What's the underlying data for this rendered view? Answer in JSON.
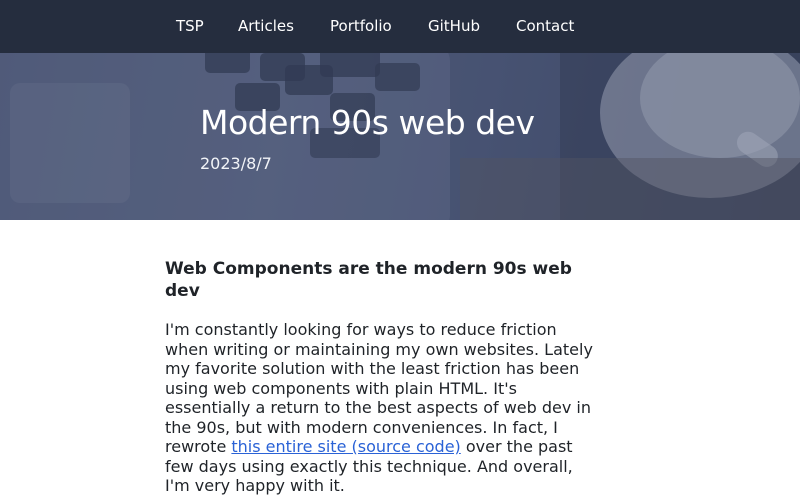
{
  "nav": {
    "items": [
      {
        "label": "TSP"
      },
      {
        "label": "Articles"
      },
      {
        "label": "Portfolio"
      },
      {
        "label": "GitHub"
      },
      {
        "label": "Contact"
      }
    ]
  },
  "hero": {
    "title": "Modern 90s web dev",
    "date": "2023/8/7"
  },
  "article": {
    "heading": "Web Components are the modern 90s web dev",
    "paragraph_before_link": "I'm constantly looking for ways to reduce friction when writing or maintaining my own websites. Lately my favorite solution with the least friction has been using web components with plain HTML. It's essentially a return to the best aspects of web dev in the 90s, but with modern conveniences. In fact, I rewrote ",
    "link_text": "this entire site (source code)",
    "paragraph_after_link": " over the past few days using exactly this technique. And overall, I'm very happy with it."
  },
  "colors": {
    "nav_background": "#252d3e",
    "hero_overlay": "#4f5a78",
    "link": "#2a62d6",
    "text": "#1f2328"
  }
}
